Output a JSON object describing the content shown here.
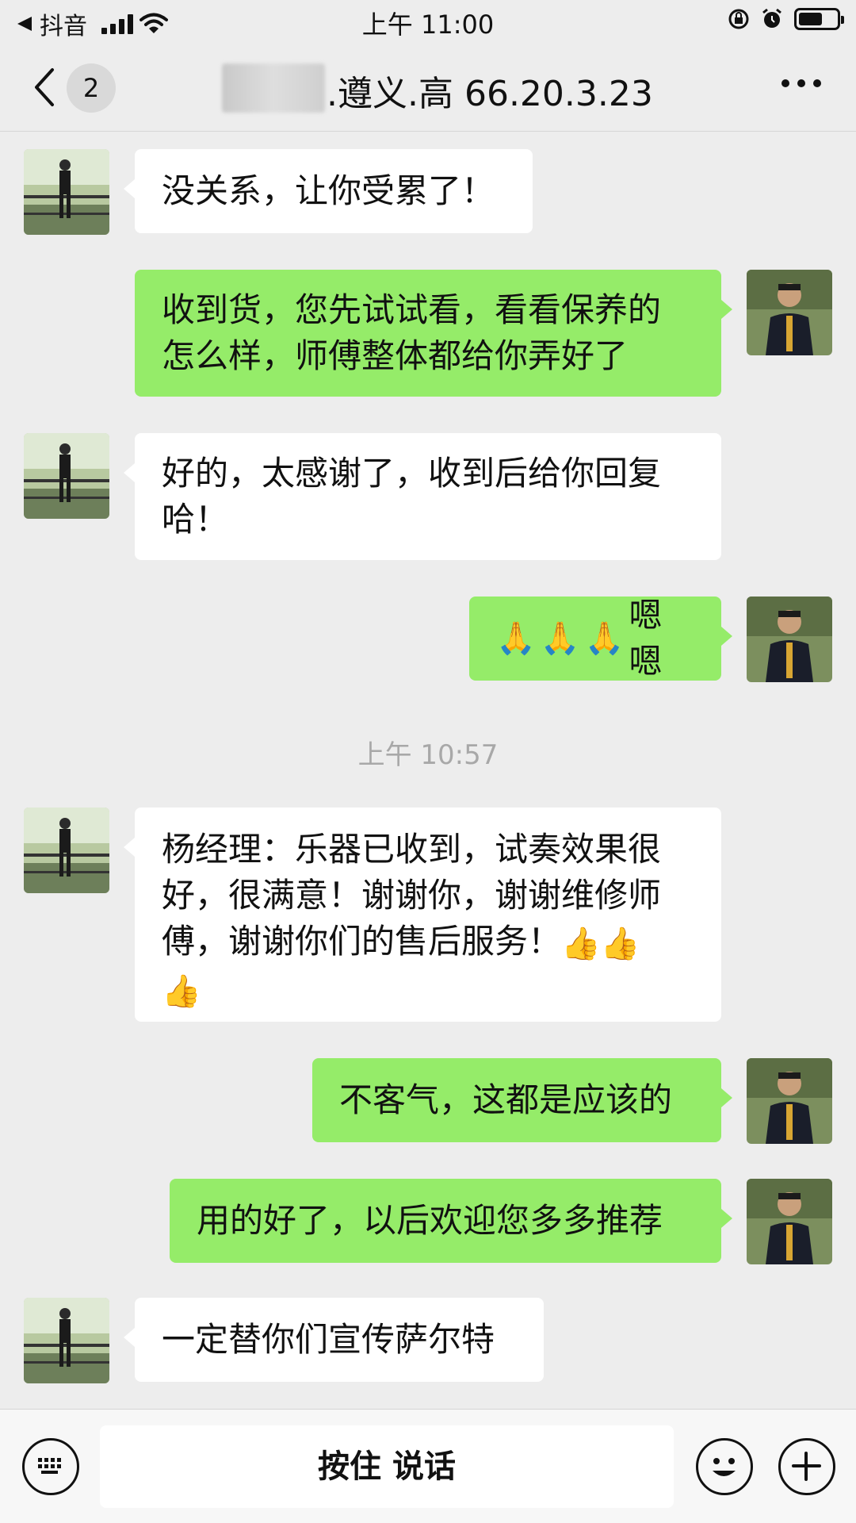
{
  "status_bar": {
    "back_app": "抖音",
    "time": "上午 11:00"
  },
  "nav": {
    "badge_count": "2",
    "title": ".遵义.高 66.20.3.23"
  },
  "messages": [
    {
      "side": "recv",
      "text": "没关系，让你受累了！"
    },
    {
      "side": "sent",
      "text": "收到货，您先试试看，看看保养的\n怎么样，师傅整体都给你弄好了"
    },
    {
      "side": "recv",
      "text": "好的，太感谢了，收到后给你回复\n哈！"
    },
    {
      "side": "sent",
      "text": "嗯嗯",
      "emojis": [
        "pray",
        "pray",
        "pray"
      ]
    },
    {
      "side": "recv",
      "text": "杨经理：乐器已收到，试奏效果很\n好，很满意！谢谢你，谢谢维修师\n傅，谢谢你们的售后服务！",
      "emojis": [
        "thumbs-up",
        "thumbs-up",
        "thumbs-up"
      ]
    },
    {
      "side": "sent",
      "text": "不客气，这都是应该的"
    },
    {
      "side": "sent",
      "text": "用的好了，以后欢迎您多多推荐"
    },
    {
      "side": "recv",
      "text": "一定替你们宣传萨尔特"
    }
  ],
  "timestamp": "上午 10:57",
  "input_bar": {
    "hold_to_talk": "按住 说话"
  },
  "colors": {
    "sent_bubble": "#95ec69",
    "recv_bubble": "#ffffff",
    "background": "#ededed"
  }
}
